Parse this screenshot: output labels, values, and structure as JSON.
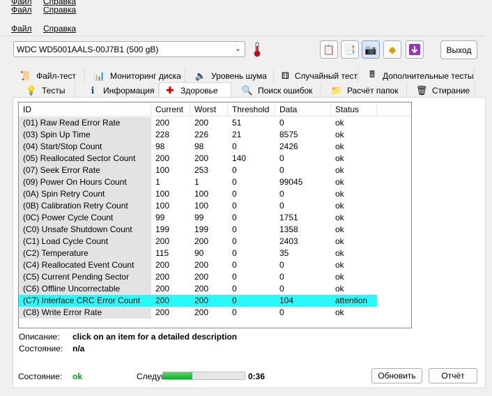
{
  "menu": {
    "file": "Файл",
    "help": "Справка"
  },
  "disk": {
    "selected": "WDC WD5001AALS-00J7B1 (500 gB)"
  },
  "toolbar": {
    "exit": "Выход"
  },
  "tabs_row1": [
    {
      "label": "Файл-тест",
      "icon": "file-test-icon"
    },
    {
      "label": "Мониторинг диска",
      "icon": "chart-icon"
    },
    {
      "label": "Уровень шума",
      "icon": "speaker-icon"
    },
    {
      "label": "Случайный тест",
      "icon": "dice-icon"
    },
    {
      "label": "Дополнительные тесты",
      "icon": "calculator-icon"
    }
  ],
  "tabs_row2": [
    {
      "label": "Тесты",
      "icon": "bulb-icon"
    },
    {
      "label": "Информация",
      "icon": "info-icon"
    },
    {
      "label": "Здоровье",
      "icon": "health-cross-icon",
      "selected": true
    },
    {
      "label": "Поиск ошибок",
      "icon": "magnifier-icon"
    },
    {
      "label": "Расчёт папок",
      "icon": "folder-icon"
    },
    {
      "label": "Стирание",
      "icon": "trash-icon"
    }
  ],
  "table": {
    "columns": [
      "ID",
      "Current",
      "Worst",
      "Threshold",
      "Data",
      "Status"
    ],
    "rows": [
      [
        "(01) Raw Read Error Rate",
        "200",
        "200",
        "51",
        "0",
        "ok"
      ],
      [
        "(03) Spin Up Time",
        "228",
        "226",
        "21",
        "8575",
        "ok"
      ],
      [
        "(04) Start/Stop Count",
        "98",
        "98",
        "0",
        "2426",
        "ok"
      ],
      [
        "(05) Reallocated Sector Count",
        "200",
        "200",
        "140",
        "0",
        "ok"
      ],
      [
        "(07) Seek Error Rate",
        "100",
        "253",
        "0",
        "0",
        "ok"
      ],
      [
        "(09) Power On Hours Count",
        "1",
        "1",
        "0",
        "99045",
        "ok"
      ],
      [
        "(0A) Spin Retry Count",
        "100",
        "100",
        "0",
        "0",
        "ok"
      ],
      [
        "(0B) Calibration Retry Count",
        "100",
        "100",
        "0",
        "0",
        "ok"
      ],
      [
        "(0C) Power Cycle Count",
        "99",
        "99",
        "0",
        "1751",
        "ok"
      ],
      [
        "(C0) Unsafe Shutdown Count",
        "199",
        "199",
        "0",
        "1358",
        "ok"
      ],
      [
        "(C1) Load Cycle Count",
        "200",
        "200",
        "0",
        "2403",
        "ok"
      ],
      [
        "(C2) Temperature",
        "115",
        "90",
        "0",
        "35",
        "ok"
      ],
      [
        "(C4) Reallocated Event Count",
        "200",
        "200",
        "0",
        "0",
        "ok"
      ],
      [
        "(C5) Current Pending Sector",
        "200",
        "200",
        "0",
        "0",
        "ok"
      ],
      [
        "(C6) Offline Uncorrectable",
        "200",
        "200",
        "0",
        "0",
        "ok"
      ],
      [
        "(C7) Interface CRC Error Count",
        "200",
        "200",
        "0",
        "104",
        "attention"
      ],
      [
        "(C8) Write Error Rate",
        "200",
        "200",
        "0",
        "0",
        "ok"
      ]
    ],
    "highlight_row": 15,
    "highlight_color": "#28fafa"
  },
  "details": {
    "desc_label": "Описание:",
    "desc_value": "click on an item for a detailed description",
    "state_label": "Состояние:",
    "state_value": "n/a"
  },
  "status": {
    "label": "Состояние:",
    "value": "ok",
    "value_color": "#00a000",
    "next_label": "Следую",
    "progress": 0.36,
    "time": "0:36",
    "refresh": "Обновить",
    "report": "Отчёт"
  }
}
